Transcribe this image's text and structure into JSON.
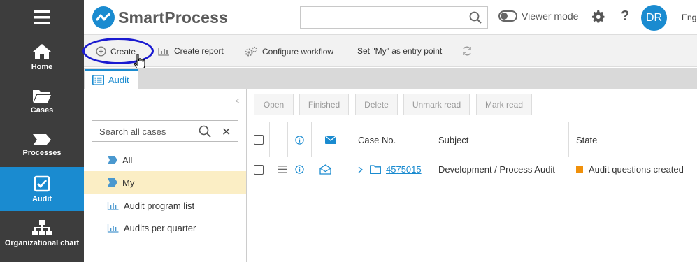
{
  "app": {
    "brand": "SmartProcess",
    "brand_color": "#1a8bd0"
  },
  "nav": [
    {
      "label": "Home",
      "icon": "home-icon"
    },
    {
      "label": "Cases",
      "icon": "folder-icon"
    },
    {
      "label": "Processes",
      "icon": "process-arrow-icon"
    },
    {
      "label": "Audit",
      "icon": "checkbox-icon",
      "active": true
    },
    {
      "label": "Organizational chart",
      "icon": "org-chart-icon"
    }
  ],
  "header": {
    "search_placeholder": "",
    "viewer_mode_label": "Viewer mode",
    "help_label": "?",
    "avatar_initials": "DR",
    "language_label": "Eng"
  },
  "toolbar": {
    "create_label": "Create",
    "create_report_label": "Create report",
    "configure_workflow_label": "Configure workflow",
    "set_my_entry_label": "Set \"My\" as entry point"
  },
  "tab": {
    "label": "Audit"
  },
  "left_panel": {
    "search_placeholder": "Search all cases",
    "items": [
      {
        "label": "All",
        "icon": "flag-icon"
      },
      {
        "label": "My",
        "icon": "flag-icon",
        "selected": true
      },
      {
        "label": "Audit program list",
        "icon": "bar-chart-icon"
      },
      {
        "label": "Audits per quarter",
        "icon": "bar-chart-icon"
      }
    ]
  },
  "actions": {
    "open_label": "Open",
    "finished_label": "Finished",
    "delete_label": "Delete",
    "unmark_read_label": "Unmark read",
    "mark_read_label": "Mark read"
  },
  "table": {
    "columns": [
      "Case No.",
      "Subject",
      "State"
    ],
    "rows": [
      {
        "case_no": "4575015",
        "subject": "Development / Process Audit",
        "state": "Audit questions created",
        "state_color": "#f0900a"
      }
    ]
  }
}
